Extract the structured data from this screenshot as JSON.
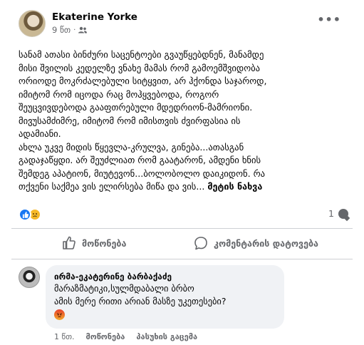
{
  "post": {
    "author": "Ekaterine Yorke",
    "time": "9 წთ",
    "privacy_icon": "friends-icon",
    "menu_icon": "more-icon",
    "text_lines": [
      "სანამ ათასი ბინძური საცენტოები გვაუწყებდნენ, მანამდე",
      "მისი შვილის კედელზე ვნახე მამას რომ გამოემშვიდობა",
      "ორიოდე მოკრძალებული სიტყვით, არ ჰქონდა საჯაროდ,",
      "იმიტომ რომ იცოდა რაც მოჰყვებოდა, როგორ",
      "შეუცვივდებოდა გააფთრებული მდედრიონ-მამრიონი.",
      "მივუსამძიმრე, იმიტომ რომ იმისთვის ძვირფასია ის",
      "ადამიანი.",
      "ახლა უკვე მიდის წყევლა-კრულვა, გინება...ათასგან",
      "გადაჯაწყდი. არ შეუძლიათ რომ გაატარონ, ამდენი ხნის",
      "შემდეგ აპატიონ, მიუტევონ...ბოლობოლო დაიკიდონ. რა",
      "თქვენი საქმეა ვის ელირსება მიწა და ვის..."
    ],
    "see_more": "მეტის ნახვა",
    "comment_count": "1",
    "reactions": [
      "like",
      "sad"
    ]
  },
  "actions": {
    "like_label": "მოწონება",
    "comment_label": "კომენტარის დატოვება"
  },
  "comment": {
    "author": "ირმა-ეკატერინე ბარბაქაძე",
    "text_lines": [
      "მარაზმატიკი,სულმდაბალი ბრბო",
      "ამის მერე რითი არიან მასზე უკეთესები?"
    ],
    "emoji": "angry",
    "time": "1 წთ.",
    "like_label": "მოწონება",
    "reply_label": "პასუხის გაცემა"
  },
  "colors": {
    "accent": "#1877f2",
    "secondary_text": "#65676b",
    "bubble": "#f0f2f5"
  }
}
